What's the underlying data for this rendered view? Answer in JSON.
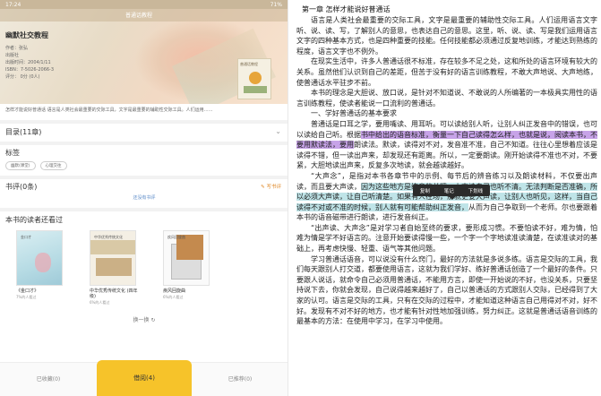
{
  "status": {
    "time": "17:24",
    "battery": "71%"
  },
  "hero": {
    "band_title": "普通话教程"
  },
  "book": {
    "title": "幽默社交教程",
    "author": "作者：张弘",
    "publisher": "出版社",
    "date": "出版时间：2004/1/11",
    "isbn": "ISBN：7-5026-2066-3",
    "rating": "评分：",
    "rating_value": "0分 (0人)",
    "cover_text": "普通话教程"
  },
  "description": "怎样才能说好普通话 语言是人类社会最重要的交际工具，文字是最重要的辅助性交际工具。人们运用……",
  "toc": {
    "label": "目录(11章)"
  },
  "tags": {
    "label": "标签",
    "items": [
      "幽默(课堂)",
      "心理交往"
    ]
  },
  "reviews": {
    "label": "书评(0条)",
    "write": "写书评",
    "empty": "还没有书评"
  },
  "readers": {
    "label": "本书的读者还看过",
    "books": [
      {
        "title": "《金口才》",
        "count": "7%的人看过",
        "cover_text": "金口才"
      },
      {
        "title": "中华优秀传统文化 (四年级)",
        "count": "6%的人看过",
        "cover_text": "中华优秀传统文化"
      },
      {
        "title": "疾风回旋曲",
        "count": "6%的人看过",
        "cover_text": "疾风回旋曲"
      }
    ]
  },
  "refresh": "换一换 ↻",
  "bottom": {
    "left": "已收藏(0)",
    "center": "借阅(4)",
    "right": "已推荐(0)"
  },
  "reader": {
    "chapter": "第一章 怎样才能说好普通话",
    "p1": "语言是人类社会最重要的交际工具，文字是最重要的辅助性交际工具。人们运用语言文字听、说、读、写，了解别人的意思，也表达自己的意思。这里，听、说、读、写是我们运用语言文字的四种基本方式，也是四种重要的技能。任何技能都必须通过反复地训练，才能达到熟练的程度，语言文字也不例外。",
    "p2": "在现实生活中，许多人普通话很不标准，存在较多不足之处，这和所处的语言环境有较大的关系。虽然他们认识到自己的差距，但苦于没有好的语言训练教程，不敢大声地说、大声地练，使普通话水平驻步不前。",
    "p3": "本书的理念是大胆说、放口说，是针对不知道说、不敢说的人所编著的一本极具实用性的语言训练教程，使读者能说一口流利的普通话。",
    "h1": "一、学好普通话的基本要求",
    "p4_a": "普通话是口耳之学，要用嘴读、用耳听。可以读给别人听，让别人纠正发音中的错误，也可以读给自己听。根据",
    "p4_hl": "书中给出的语音标准，衡量一下自己读得怎么样，也就是说，阅读本书，不要用默读法，要用",
    "p4_b": "朗读法。默读，读得对不对，发音准不准，自己不知道。往往心里想着应该是读得不错，但一读出声来，却发现还有距离。所以，一定要朗读。刚开始读得不准也不对，不要紧，大胆地读出声来，反复多次地读，就会越读越好。",
    "p5_a": "“大声念”，是指对本书各章节中的示例、每节后的辨音练习以及朗读材料，不仅要出声读，而且要大声读，",
    "p5_hl": "因为这些地方是练音的关键，小声读自己也听不清。无法判断是否准确，所以必须大声读，让自己听清楚。如果有人在场，那就更要大声读，让别人也听见，这样，当自己读得不对或不准的时候，别人就有可能帮助纠正发音，",
    "p5_b": "从而为自己争取到一个老师。尔也要跟着本书的语音磁带进行朗读，进行发音纠正。",
    "p6": "“出声读、大声念”是对学习者自始至终的要求，要形成习惯。不要怕读不好，难为情，怕难为情是学不好语言的。注意开始要读得慢一些，一个字一个字地读准读清楚，在读准读对的基础上，再考虑快慢、轻重、语气等其他问题。",
    "p7": "学习普通话语音，可以说没有什么窍门，最好的方法就是多说多练。语言是交际的工具，我们每天跟别人打交道，都要使用语言，这就为我们学好、练好普通话创造了一个最好的条件。只要跟人说话，就命令自己必须用普通话，不能用方言，即使一开始说的不好，也没关系，只要坚持说下去，你就会发现，自己说得越来越好了，自己以普通话的方式跟别人交际，已经得到了大家的认可。语言是交际的工具，只有在交际的过程中，才能知道这种语言自己用得对不对，好不好。发现有不对不好的地方，也才能有针对性地加强训练，努力纠正。这就是普通话语音训练的最基本的方法：在使用中学习，在学习中使用。",
    "popup": {
      "copy": "复制",
      "note": "笔记",
      "underline": "下划线"
    }
  }
}
